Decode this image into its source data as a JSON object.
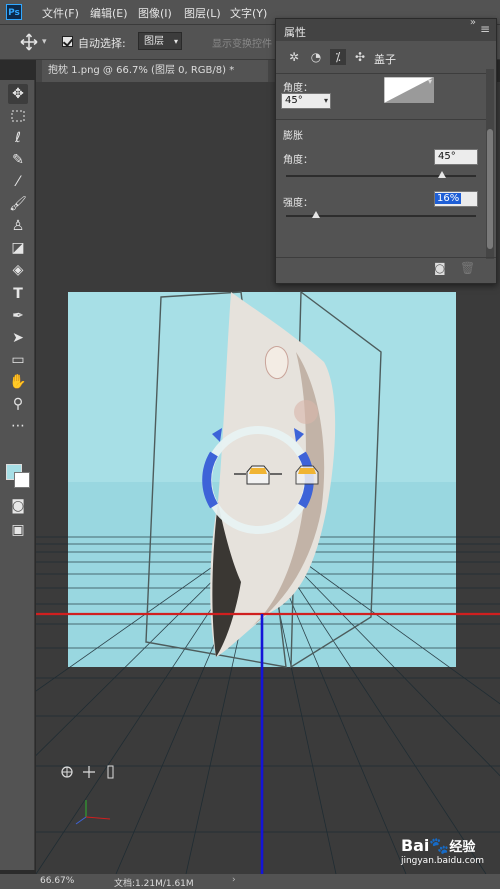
{
  "app": {
    "logo": "Ps"
  },
  "menu": [
    "文件(F)",
    "编辑(E)",
    "图像(I)",
    "图层(L)",
    "文字(Y)"
  ],
  "options": {
    "auto_select_label": "自动选择:",
    "auto_select_value": "图层",
    "extra_label": "显示变换控件"
  },
  "document_tab": {
    "title": "抱枕 1.png @ 66.7% (图层 0, RGB/8) *"
  },
  "properties_panel": {
    "title": "属性",
    "tab_caps": "盖子",
    "cap_angle_label": "角度：",
    "cap_angle_value": "45°",
    "inflate_section": "膨胀",
    "inflate_angle_label": "角度：",
    "inflate_angle_value": "45°",
    "strength_label": "强度：",
    "strength_value": "16%",
    "inflate_angle_slider": 0.82,
    "strength_slider": 0.16
  },
  "status": {
    "zoom": "66.67%",
    "doc_size": "文档:1.21M/1.61M"
  },
  "watermark": {
    "brand": "Bai",
    "brand2": "经验",
    "url": "jingyan.baidu.com"
  },
  "colors": {
    "ui_bg": "#535353",
    "canvas_bg": "#3b3b3b",
    "sky": "#a7dfe6",
    "red_axis": "#d01f1f",
    "blue_axis": "#1414d8"
  }
}
